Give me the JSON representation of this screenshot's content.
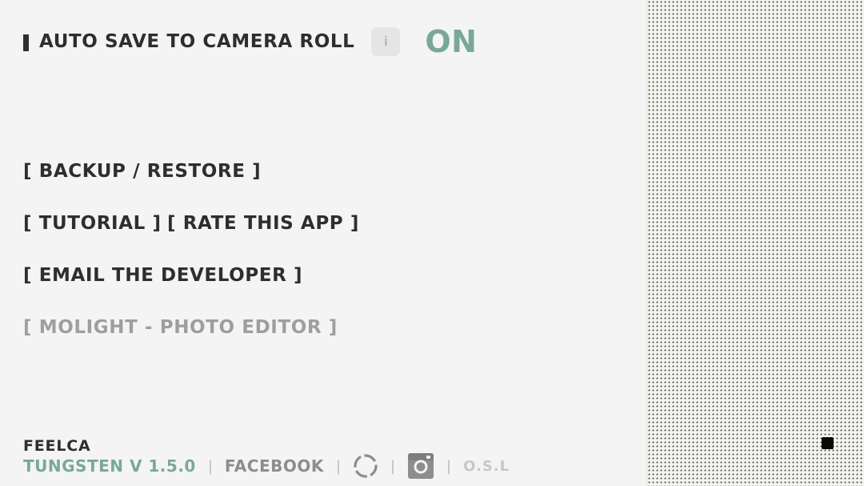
{
  "settings": {
    "autosave_label": "AUTO SAVE TO CAMERA ROLL",
    "info_label": "i",
    "autosave_state": "ON"
  },
  "menu": {
    "backup": "[ BACKUP / RESTORE ]",
    "tutorial": "[ TUTORIAL ]",
    "rate": "[ RATE THIS APP ]",
    "email": "[ EMAIL THE DEVELOPER ]",
    "molight": "[ MOLIGHT - PHOTO EDITOR ]"
  },
  "footer": {
    "brand": "FEELCA",
    "version": "TUNGSTEN V 1.5.0",
    "separator": "|",
    "facebook": "FACEBOOK",
    "osl": "O.S.L"
  },
  "icons": {
    "bar": "bar-icon",
    "loader": "loader-ring-icon",
    "instagram": "instagram-icon"
  },
  "colors": {
    "accent": "#7aa898",
    "text": "#2e2e2e",
    "dim_text": "#9e9e9e",
    "background": "#f4f4f4"
  }
}
